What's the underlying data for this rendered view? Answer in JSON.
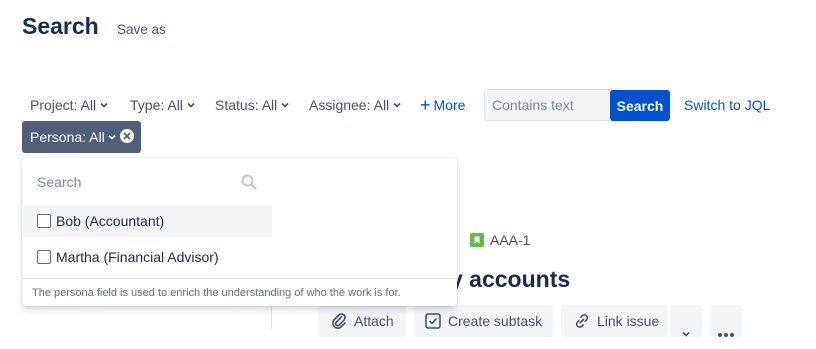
{
  "page": {
    "title": "Search",
    "save_as": "Save as"
  },
  "filters": {
    "project": "Project: All",
    "type": "Type: All",
    "status": "Status: All",
    "assignee": "Assignee: All",
    "more": "More",
    "text_placeholder": "Contains text",
    "search_button": "Search",
    "switch_jql": "Switch to JQL",
    "persona": "Persona: All"
  },
  "persona_dropdown": {
    "search_placeholder": "Search",
    "options": [
      {
        "label": "Bob (Accountant)",
        "checked": false
      },
      {
        "label": "Martha (Financial Advisor)",
        "checked": false
      }
    ],
    "footer": "The persona field is used to enrich the understanding of who the work is for."
  },
  "issue": {
    "key": "AAA-1",
    "title_fragment": "y accounts",
    "actions": {
      "attach": "Attach",
      "create_subtask": "Create subtask",
      "link_issue": "Link issue"
    }
  },
  "icons": {
    "chevron": "chevron-down-icon",
    "plus": "plus-icon",
    "clear": "close-circle-icon",
    "search": "search-icon",
    "story": "bookmark-icon",
    "attach": "paperclip-icon",
    "subtask": "subtask-icon",
    "link": "link-icon",
    "more": "more-icon"
  },
  "colors": {
    "primary": "#0052cc",
    "pill_bg": "#505f79",
    "story": "#65ba43",
    "text": "#172b4d",
    "subtle_text": "#42526e"
  }
}
